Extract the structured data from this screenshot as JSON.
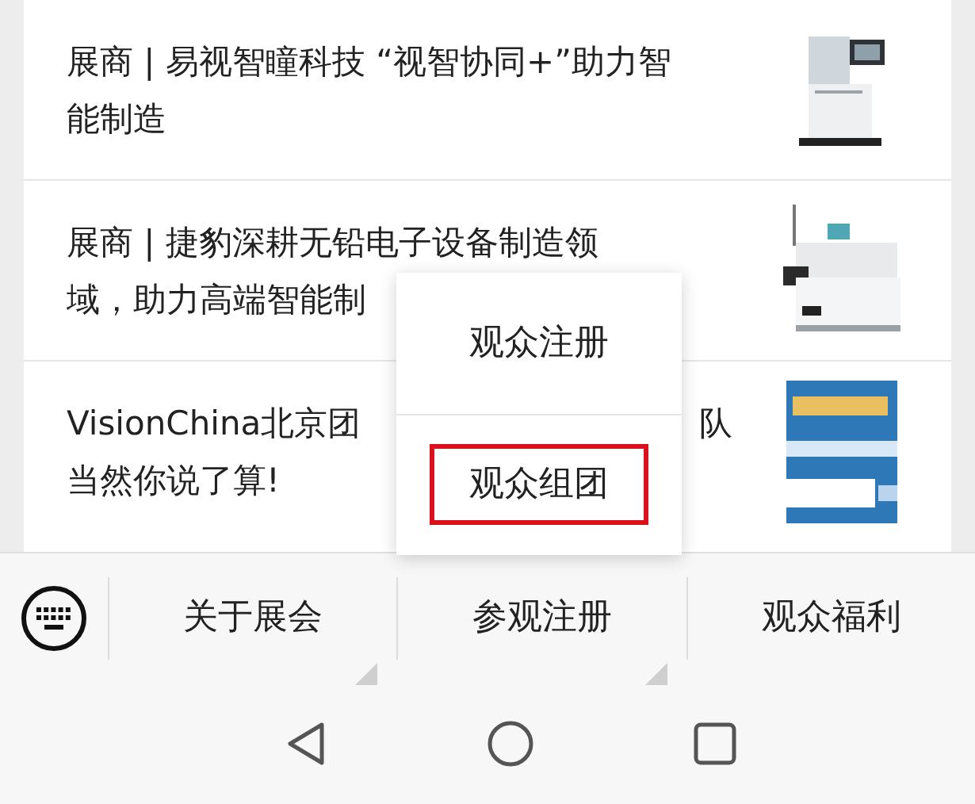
{
  "articles": [
    {
      "lines": [
        [
          "展商 | 易视智瞳科技 “视智协同+”助力智"
        ],
        [
          "能制造"
        ]
      ],
      "thumbnail": {
        "kind": "picture"
      }
    },
    {
      "lines": [
        [
          "展商 | 捷豹深耕无铅电子设备制造领"
        ],
        [
          "域，助力高端智能制"
        ]
      ],
      "thumbnail": {
        "kind": "picture"
      }
    },
    {
      "lines": [
        [
          "VisionChina北京团",
          "队"
        ],
        [
          "当然你说了算!"
        ]
      ],
      "thumbnail": {
        "kind": "picture"
      }
    }
  ],
  "popup_menu": {
    "items": [
      {
        "label": "观众注册",
        "highlighted": false
      },
      {
        "label": "观众组团",
        "highlighted": true
      }
    ]
  },
  "bottom_menu": [
    {
      "label": "关于展会",
      "has_submenu": true
    },
    {
      "label": "参观注册",
      "has_submenu": true
    },
    {
      "label": "观众福利",
      "has_submenu": false
    }
  ]
}
